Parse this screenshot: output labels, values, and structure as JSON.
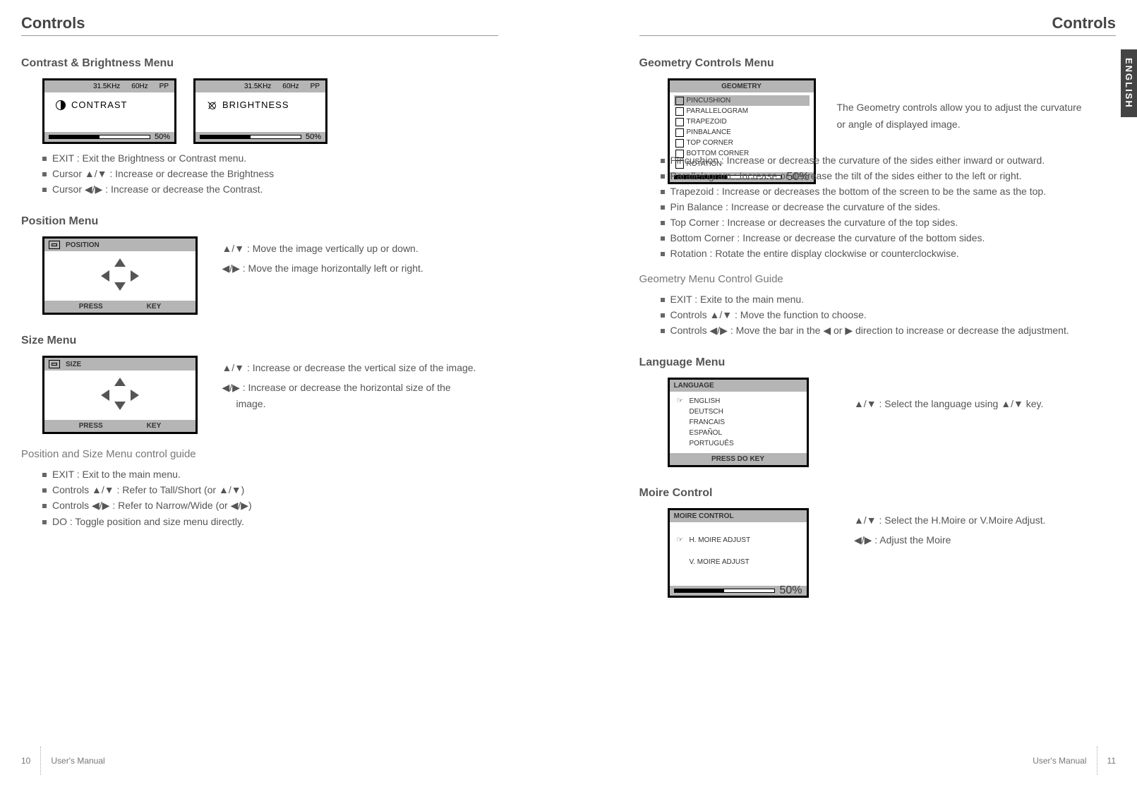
{
  "header": {
    "title": "Controls"
  },
  "left": {
    "contrast_brightness": {
      "title": "Contrast & Brightness Menu",
      "freq": "31.5KHz",
      "refresh": "60Hz",
      "mode": "PP",
      "contrast_label": "CONTRAST",
      "brightness_label": "BRIGHTNESS",
      "percent": "50%",
      "bullets": [
        "EXIT : Exit the Brightness or Contrast menu.",
        "Cursor ▲/▼ : Increase or decrease the Brightness",
        "Cursor ◀/▶ : Increase or decrease the Contrast."
      ]
    },
    "position": {
      "title": "Position Menu",
      "osd_title": "POSITION",
      "press": "PRESS",
      "key": "KEY",
      "desc": [
        "▲/▼ : Move the image vertically up or down.",
        "◀/▶ : Move the image horizontally left or right."
      ]
    },
    "size": {
      "title": "Size Menu",
      "osd_title": "SIZE",
      "press": "PRESS",
      "key": "KEY",
      "desc": [
        "▲/▼ : Increase or decrease the vertical size of the image.",
        "◀/▶ : Increase or decrease the horizontal size of the image."
      ]
    },
    "possize_guide": {
      "title": "Position and Size Menu control guide",
      "bullets": [
        "EXIT : Exit to the main menu.",
        "Controls ▲/▼ : Refer to Tall/Short (or ▲/▼)",
        "Controls ◀/▶ : Refer to Narrow/Wide (or ◀/▶)",
        "DO : Toggle position and size menu directly."
      ]
    },
    "footer": {
      "page": "10",
      "manual": "User's Manual"
    }
  },
  "right": {
    "geometry": {
      "title": "Geometry Controls Menu",
      "osd_title": "GEOMETRY",
      "items": [
        "PINCUSHION",
        "PARALLELOGRAM",
        "TRAPEZOID",
        "PINBALANCE",
        "TOP CORNER",
        "BOTTOM CORNER",
        "ROTATION"
      ],
      "percent": "50%",
      "intro": "The Geometry controls allow you to adjust the curvature or angle of displayed image.",
      "bullets": [
        "Pincushion : Increase or decrease the curvature of the sides either inward or outward.",
        "Parallelogram : Increase or decrease the tilt of the sides either to the left or right.",
        "Trapezoid : Increase or decreases the bottom of the screen to be the same as the top.",
        "Pin Balance : Increase or decrease the curvature of the sides.",
        "Top Corner : Increase or decreases the curvature of the top sides.",
        "Bottom Corner : Increase or decrease the curvature of the bottom sides.",
        "Rotation : Rotate the entire display clockwise or counterclockwise."
      ],
      "guide_title": "Geometry Menu Control Guide",
      "guide": [
        "EXIT : Exite to the main menu.",
        "Controls ▲/▼ : Move the function to choose.",
        "Controls ◀/▶ : Move the bar in the ◀ or ▶ direction to increase or decrease the adjustment."
      ]
    },
    "language": {
      "title": "Language Menu",
      "osd_title": "LANGUAGE",
      "items": [
        "ENGLISH",
        "DEUTSCH",
        "FRANCAIS",
        "ESPAÑOL",
        "PORTUGUÊS"
      ],
      "foot": "PRESS DO KEY",
      "desc": "▲/▼ : Select the language using ▲/▼ key."
    },
    "moire": {
      "title": "Moire Control",
      "osd_title": "MOIRE CONTROL",
      "items": [
        "H. MOIRE ADJUST",
        "V. MOIRE ADJUST"
      ],
      "percent": "50%",
      "desc": [
        "▲/▼ : Select the H.Moire or V.Moire Adjust.",
        "◀/▶ : Adjust the Moire"
      ]
    },
    "footer": {
      "manual": "User's Manual",
      "page": "11"
    },
    "lang_tab": "ENGLISH"
  }
}
